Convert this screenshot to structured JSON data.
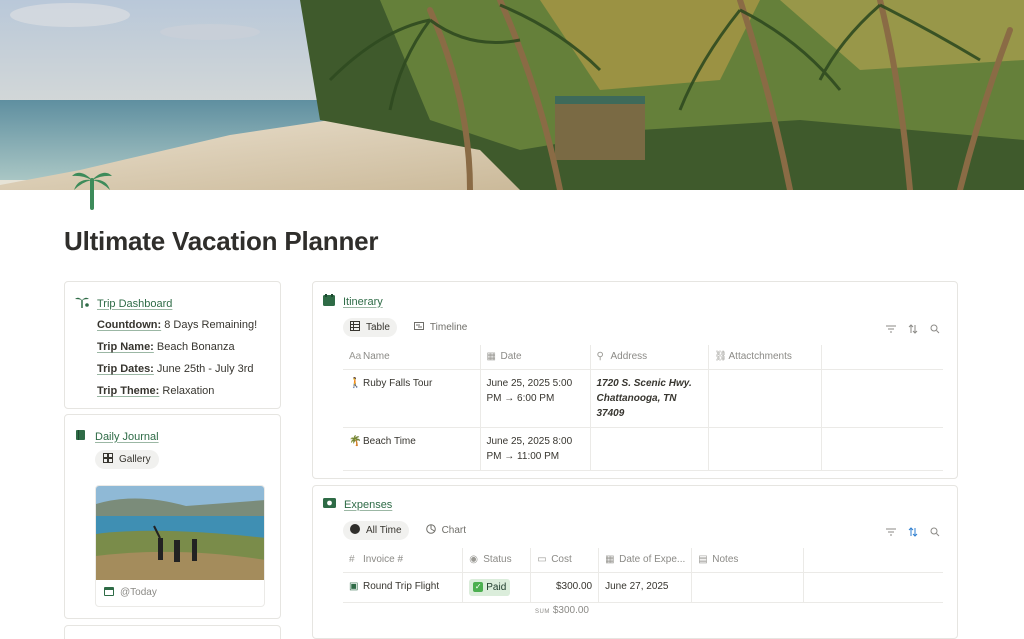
{
  "page": {
    "title": "Ultimate Vacation Planner",
    "page_icon": "palm-tree-icon"
  },
  "dashboard": {
    "title": "Trip Dashboard",
    "rows": [
      {
        "label": "Countdown:",
        "value": "8 Days Remaining!"
      },
      {
        "label": "Trip Name:",
        "value": "Beach Bonanza"
      },
      {
        "label": "Trip Dates:",
        "value": "June 25th - July 3rd"
      },
      {
        "label": "Trip Theme:",
        "value": "Relaxation"
      }
    ]
  },
  "journal": {
    "title": "Daily Journal",
    "view": "Gallery",
    "card_caption": "@Today"
  },
  "itinerary": {
    "title": "Itinerary",
    "tabs": [
      "Table",
      "Timeline"
    ],
    "columns": [
      "Name",
      "Date",
      "Address",
      "Attactchments"
    ],
    "rows": [
      {
        "name": "Ruby Falls Tour",
        "date_line1": "June 25, 2025 5:00",
        "date_line2": "PM → 6:00 PM",
        "addr_line1": "1720 S. Scenic Hwy.",
        "addr_line2": "Chattanooga, TN",
        "addr_line3": "37409"
      },
      {
        "name": "Beach Time",
        "date_line1": "June 25, 2025 8:00",
        "date_line2": "PM → 11:00 PM"
      }
    ]
  },
  "expenses": {
    "title": "Expenses",
    "tabs": [
      "All Time",
      "Chart"
    ],
    "columns": [
      "Invoice #",
      "Status",
      "Cost",
      "Date of Expe...",
      "Notes"
    ],
    "rows": [
      {
        "invoice": "Round Trip Flight",
        "status": "Paid",
        "cost": "$300.00",
        "date": "June 27, 2025",
        "notes": ""
      }
    ],
    "sum_label": "SUM",
    "sum_value": "$300.00"
  },
  "colors": {
    "accent_green": "#2e6b46",
    "paid_bg": "#dbeddb"
  }
}
